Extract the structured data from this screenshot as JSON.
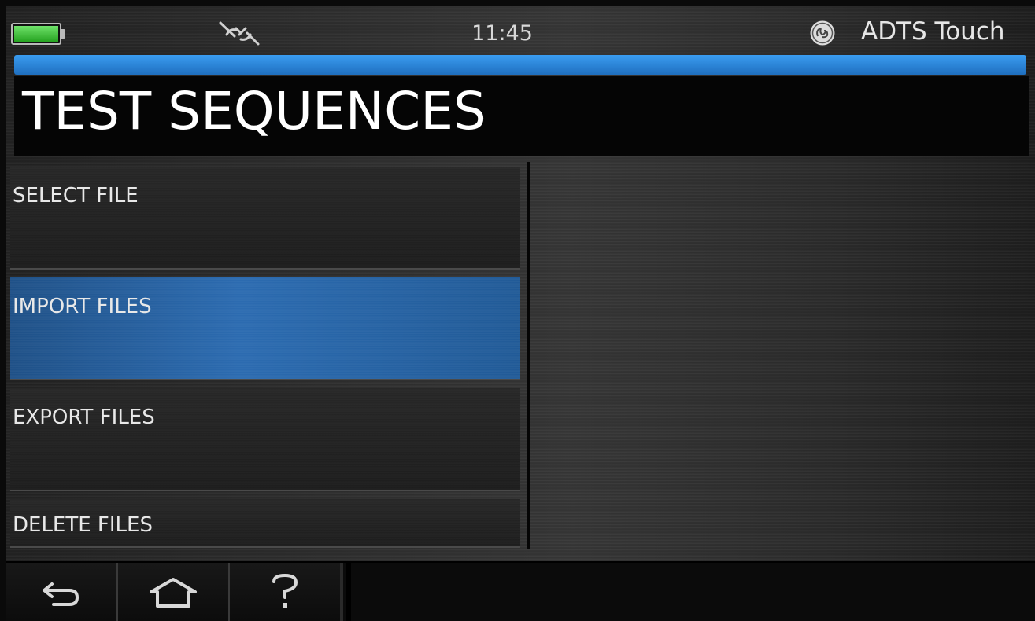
{
  "status": {
    "time": "11:45",
    "app_name": "ADTS Touch",
    "battery_icon": "battery-full-icon",
    "connection_icon": "disconnected-plug-icon",
    "brand_icon": "ge-logo-icon"
  },
  "title": "TEST SEQUENCES",
  "menu": {
    "items": [
      {
        "label": "SELECT FILE",
        "active": false
      },
      {
        "label": "IMPORT FILES",
        "active": true
      },
      {
        "label": "EXPORT FILES",
        "active": false
      },
      {
        "label": "DELETE FILES",
        "active": false
      }
    ]
  },
  "nav": {
    "buttons": [
      "back-arrow-icon",
      "home-icon",
      "help-icon"
    ]
  },
  "colors": {
    "accent_blue": "#2a6ab0",
    "progress_blue": "#3a9cf0",
    "battery_green": "#4cc447"
  }
}
